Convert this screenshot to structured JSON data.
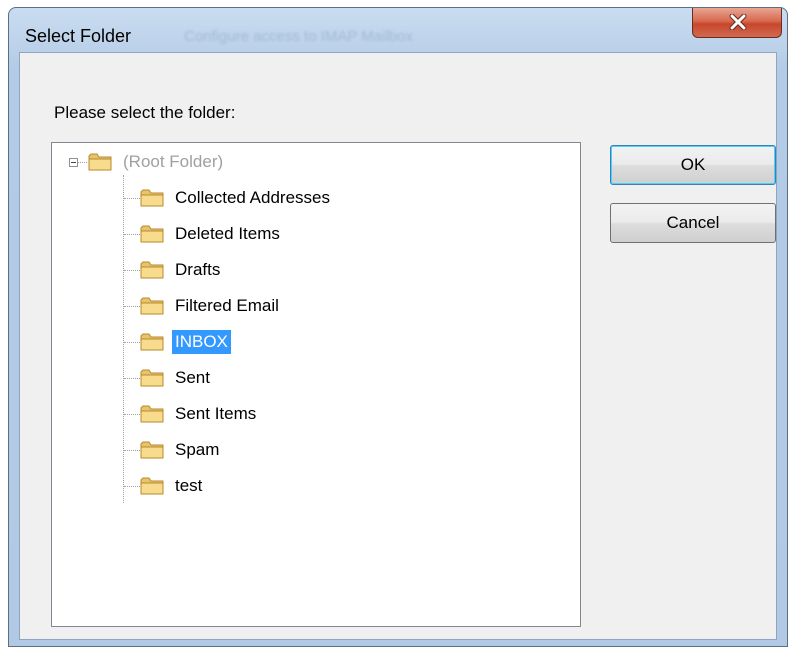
{
  "window": {
    "title": "Select Folder",
    "title_background_text": "Configure access to IMAP Mailbox"
  },
  "prompt": "Please select the folder:",
  "tree": {
    "root": {
      "label": "(Root Folder)",
      "expanded": true,
      "disabled": true
    },
    "items": [
      {
        "label": "Collected Addresses",
        "selected": false
      },
      {
        "label": "Deleted Items",
        "selected": false
      },
      {
        "label": "Drafts",
        "selected": false
      },
      {
        "label": "Filtered Email",
        "selected": false
      },
      {
        "label": "INBOX",
        "selected": true
      },
      {
        "label": "Sent",
        "selected": false
      },
      {
        "label": "Sent Items",
        "selected": false
      },
      {
        "label": "Spam",
        "selected": false
      },
      {
        "label": "test",
        "selected": false
      }
    ]
  },
  "buttons": {
    "ok": "OK",
    "cancel": "Cancel"
  },
  "icons": {
    "close": "close-icon",
    "folder": "folder-icon",
    "expander": "collapse-icon"
  },
  "colors": {
    "selection": "#3399ff",
    "close_button": "#c7472c"
  }
}
